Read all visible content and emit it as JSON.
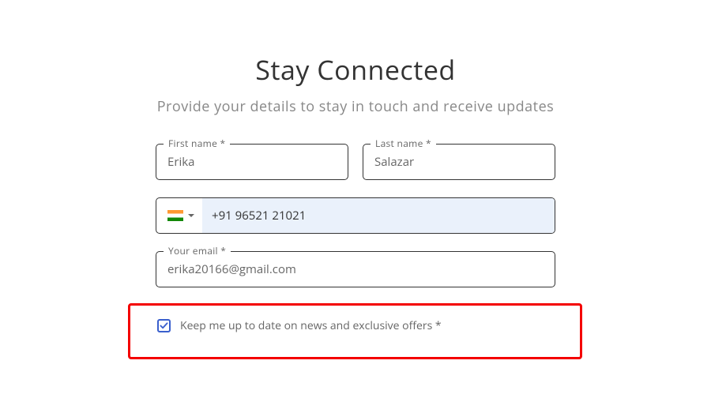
{
  "title": "Stay Connected",
  "subtitle": "Provide your details to stay in touch and receive updates",
  "form": {
    "first_name": {
      "label": "First name *",
      "value": "Erika"
    },
    "last_name": {
      "label": "Last name *",
      "value": "Salazar"
    },
    "phone": {
      "value": "+91 96521 21021",
      "country": "India"
    },
    "email": {
      "label": "Your email *",
      "value": "erika20166@gmail.com"
    },
    "newsletter": {
      "label": "Keep me up to date on news and exclusive offers *",
      "checked": true
    }
  }
}
